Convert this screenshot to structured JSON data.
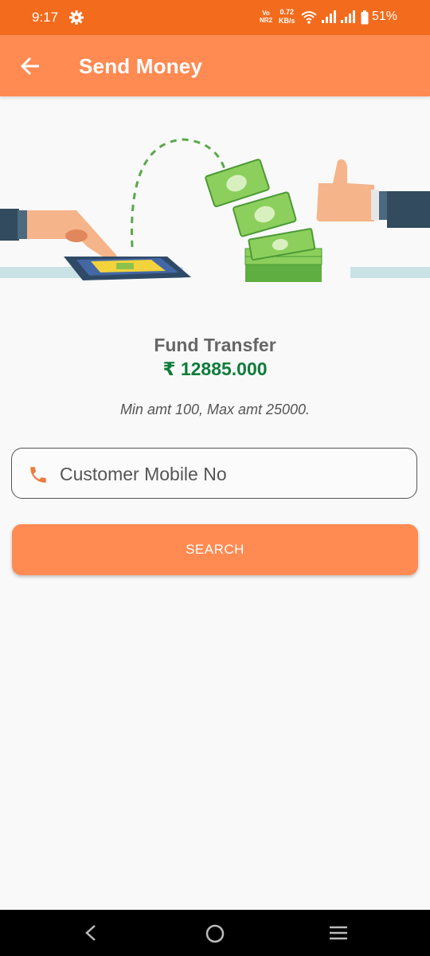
{
  "status_bar": {
    "time": "9:17",
    "network_top": "Vo",
    "network_bottom": "NR2",
    "speed_value": "0.72",
    "speed_unit": "KB/s",
    "battery": "51%"
  },
  "app_bar": {
    "title": "Send Money",
    "back_icon": "arrow-left-icon"
  },
  "fund": {
    "title": "Fund Transfer",
    "balance": "₹ 12885.000",
    "limits": "Min amt 100, Max amt 25000."
  },
  "mobile_field": {
    "placeholder": "Customer Mobile No",
    "value": "",
    "icon": "phone-icon"
  },
  "search_button": {
    "label": "SEARCH"
  },
  "colors": {
    "status_bar": "#f36b1c",
    "app_bar": "#ff8a52",
    "accent": "#ff8a52",
    "balance": "#0e7c3a"
  }
}
